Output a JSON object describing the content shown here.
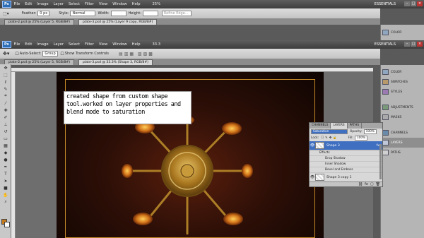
{
  "menu": {
    "app_badge": "Ps",
    "items": [
      "File",
      "Edit",
      "Image",
      "Layer",
      "Select",
      "Filter",
      "View",
      "Window",
      "Help"
    ],
    "zoom": "25%",
    "workspace": "ESSENTIALS"
  },
  "options_top": {
    "feather_label": "Feather:",
    "feather_value": "0 px",
    "style_label": "Style:",
    "style_value": "Normal",
    "width_label": "Width:",
    "height_label": "Height:",
    "refine_label": "Refine Edge..."
  },
  "tabs_top": [
    "plate-2.psd @ 25% (Layer 5, RGB/8#)",
    "plate-3.psd @ 25% (Layer 9 copy, RGB/8#)"
  ],
  "menu2": {
    "zoom": "33.3",
    "workspace": "ESSENTIALS"
  },
  "options_bottom": {
    "auto_select_label": "Auto-Select:",
    "auto_select_value": "Group",
    "transform_label": "Show Transform Controls"
  },
  "tabs_bottom": [
    "plate-2.psd @ 25% (Layer 5, RGB/8#)",
    "plate-3.psd @ 33.3% (Shape 3, RGB/8#)"
  ],
  "canvas": {
    "note_text": "created shape from custom shape tool.worked on layer properties and blend mode to saturation"
  },
  "dock_top": [
    {
      "label": "COLOR",
      "icon": "color-icon"
    }
  ],
  "dock_bottom": [
    {
      "label": "COLOR",
      "icon": "color-icon"
    },
    {
      "label": "SWATCHES",
      "icon": "swatches-icon"
    },
    {
      "label": "STYLES",
      "icon": "styles-icon"
    },
    {
      "label": "ADJUSTMENTS",
      "icon": "adjustments-icon"
    },
    {
      "label": "MASKS",
      "icon": "masks-icon"
    },
    {
      "label": "CHANNELS",
      "icon": "channels-icon"
    },
    {
      "label": "LAYERS",
      "icon": "layers-icon"
    },
    {
      "label": "PATHS",
      "icon": "paths-icon"
    }
  ],
  "layers_panel": {
    "tabs": [
      "CHANNELS",
      "LAYERS",
      "PATHS"
    ],
    "blend_mode": "Saturation",
    "opacity_label": "Opacity:",
    "opacity_value": "100%",
    "lock_label": "Lock:",
    "fill_label": "Fill:",
    "fill_value": "100%",
    "selected_layer": "Shape 3",
    "effects_label": "Effects",
    "effects": [
      "Drop Shadow",
      "Inner Shadow",
      "Bevel and Emboss"
    ],
    "next_layer": "Shape 3 copy 1"
  },
  "colors": {
    "accent": "#3f6fc1",
    "canvas_dark": "#2d0f07",
    "gold": "#c78a28",
    "foreground_swatch": "#c47a1a"
  }
}
